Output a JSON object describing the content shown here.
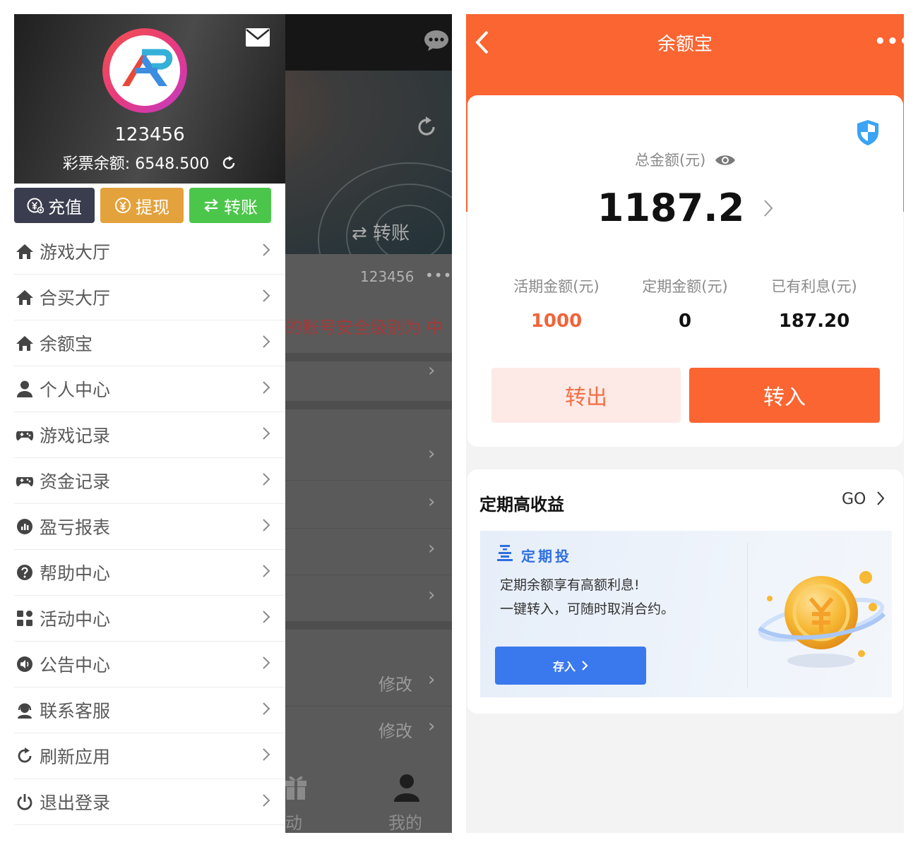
{
  "left": {
    "background": {
      "transfer_label": "⇄ 转账",
      "username": "123456",
      "more_dots": "•••",
      "warning_text": "的账号安全级别为 中",
      "edit_label_1": "修改",
      "edit_label_2": "修改",
      "tab_activity_partial": "动",
      "tab_mine": "我的"
    },
    "drawer": {
      "username": "123456",
      "balance_label": "彩票余额:",
      "balance_value": "6548.500",
      "actions": {
        "recharge": "充值",
        "withdraw": "提现",
        "transfer": "转账"
      },
      "menu": [
        {
          "label": "游戏大厅",
          "icon": "home-icon"
        },
        {
          "label": "合买大厅",
          "icon": "home-icon"
        },
        {
          "label": "余额宝",
          "icon": "home-icon"
        },
        {
          "label": "个人中心",
          "icon": "user-icon"
        },
        {
          "label": "游戏记录",
          "icon": "gamepad-icon"
        },
        {
          "label": "资金记录",
          "icon": "gamepad-icon"
        },
        {
          "label": "盈亏报表",
          "icon": "chart-icon"
        },
        {
          "label": "帮助中心",
          "icon": "question-icon"
        },
        {
          "label": "活动中心",
          "icon": "grid-icon"
        },
        {
          "label": "公告中心",
          "icon": "speaker-icon"
        },
        {
          "label": "联系客服",
          "icon": "headset-icon"
        },
        {
          "label": "刷新应用",
          "icon": "refresh-icon"
        },
        {
          "label": "退出登录",
          "icon": "power-icon"
        }
      ]
    }
  },
  "right": {
    "header": {
      "title": "余额宝",
      "more": "•••"
    },
    "summary": {
      "total_label": "总金额(元)",
      "total_value": "1187.2",
      "stats": {
        "current": {
          "label": "活期金额(元)",
          "value": "1000"
        },
        "fixed": {
          "label": "定期金额(元)",
          "value": "0"
        },
        "interest": {
          "label": "已有利息(元)",
          "value": "187.20"
        }
      },
      "transfer_out": "转出",
      "transfer_in": "转入"
    },
    "promo": {
      "title": "定期高收益",
      "go": "GO",
      "card_title": "定期投",
      "line1": "定期余额享有高额利息!",
      "line2": "一键转入，可随时取消合约。",
      "deposit_button": "存入"
    }
  },
  "colors": {
    "orange_accent": "#fa6531",
    "recharge_btn": "#3a3d4e",
    "withdraw_btn": "#e3a23b",
    "transfer_btn": "#4bc64b",
    "blue_button": "#3a78ee",
    "current_amount": "#f0643b"
  }
}
